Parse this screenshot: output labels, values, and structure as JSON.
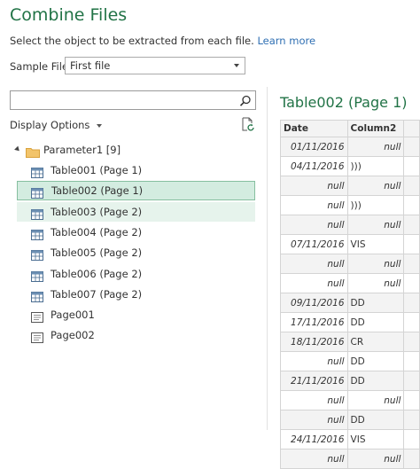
{
  "dialog": {
    "title": "Combine Files",
    "subtitle": "Select the object to be extracted from each file.",
    "learn_more": "Learn more"
  },
  "sample_file": {
    "label": "Sample File:",
    "value": "First file"
  },
  "search": {
    "placeholder": ""
  },
  "display_options": {
    "label": "Display Options"
  },
  "tree": {
    "folder": {
      "label": "Parameter1 [9]"
    },
    "items": [
      {
        "label": "Table001 (Page 1)",
        "icon": "table-icon"
      },
      {
        "label": "Table002 (Page 1)",
        "icon": "table-icon"
      },
      {
        "label": "Table003 (Page 2)",
        "icon": "table-icon"
      },
      {
        "label": "Table004 (Page 2)",
        "icon": "table-icon"
      },
      {
        "label": "Table005 (Page 2)",
        "icon": "table-icon"
      },
      {
        "label": "Table006 (Page 2)",
        "icon": "table-icon"
      },
      {
        "label": "Table007 (Page 2)",
        "icon": "table-icon"
      },
      {
        "label": "Page001",
        "icon": "page-icon"
      },
      {
        "label": "Page002",
        "icon": "page-icon"
      }
    ],
    "selected_index": 1,
    "hover_index": 2
  },
  "preview": {
    "title": "Table002 (Page 1)",
    "columns": [
      "Date",
      "Column2",
      ""
    ],
    "rows": [
      [
        "01/11/2016",
        "null",
        ""
      ],
      [
        "04/11/2016",
        ")))",
        ""
      ],
      [
        "null",
        "null",
        ""
      ],
      [
        "null",
        ")))",
        ""
      ],
      [
        "null",
        "null",
        ""
      ],
      [
        "07/11/2016",
        "VIS",
        ""
      ],
      [
        "null",
        "null",
        ""
      ],
      [
        "null",
        "null",
        ""
      ],
      [
        "09/11/2016",
        "DD",
        ""
      ],
      [
        "17/11/2016",
        "DD",
        ""
      ],
      [
        "18/11/2016",
        "CR",
        ""
      ],
      [
        "null",
        "DD",
        ""
      ],
      [
        "21/11/2016",
        "DD",
        ""
      ],
      [
        "null",
        "null",
        ""
      ],
      [
        "null",
        "DD",
        ""
      ],
      [
        "24/11/2016",
        "VIS",
        ""
      ],
      [
        "null",
        "null",
        ""
      ]
    ]
  }
}
